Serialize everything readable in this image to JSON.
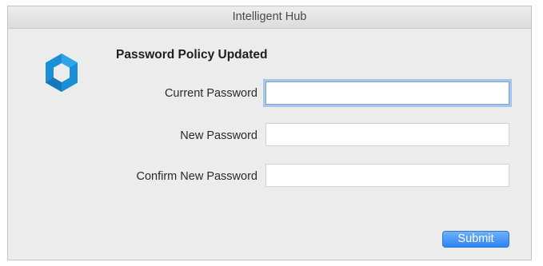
{
  "window": {
    "title": "Intelligent Hub"
  },
  "dialog": {
    "heading": "Password Policy Updated",
    "fields": [
      {
        "label": "Current Password",
        "value": "",
        "focused": true
      },
      {
        "label": "New Password",
        "value": ""
      },
      {
        "label": "Confirm New Password",
        "value": ""
      }
    ],
    "submit_label": "Submit"
  },
  "colors": {
    "accent": "#2a84f4",
    "logo_blue": "#1a8fd6",
    "window_bg": "#ececec"
  },
  "icons": {
    "logo": "intelligent-hub-logo-icon"
  }
}
